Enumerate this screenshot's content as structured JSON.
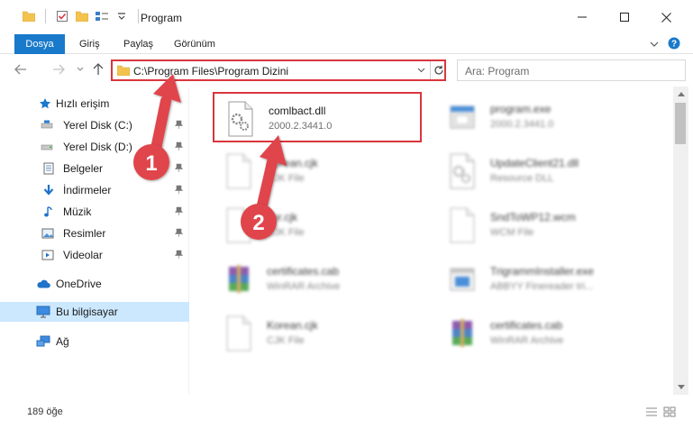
{
  "window": {
    "title": "Program"
  },
  "ribbon": {
    "tabs": [
      "Dosya",
      "Giriş",
      "Paylaş",
      "Görünüm"
    ]
  },
  "address": {
    "path": "C:\\Program Files\\Program Dizini"
  },
  "search": {
    "placeholder": "Ara: Program"
  },
  "sidebar": {
    "quick_access": "Hızlı erişim",
    "items": [
      {
        "label": "Yerel Disk (C:)",
        "icon": "drive-icon"
      },
      {
        "label": "Yerel Disk (D:)",
        "icon": "drive-icon"
      },
      {
        "label": "Belgeler",
        "icon": "documents-icon"
      },
      {
        "label": "İndirmeler",
        "icon": "download-icon"
      },
      {
        "label": "Müzik",
        "icon": "music-icon"
      },
      {
        "label": "Resimler",
        "icon": "pictures-icon"
      },
      {
        "label": "Videolar",
        "icon": "video-icon"
      }
    ],
    "onedrive": "OneDrive",
    "this_pc": "Bu bilgisayar",
    "network": "Ağ"
  },
  "files": [
    {
      "name": "comlbact.dll",
      "sub": "2000.2.3441.0",
      "icon": "dll-icon",
      "highlight": true
    },
    {
      "name": "program.exe",
      "sub": "2000.2.3441.0",
      "icon": "exe-icon"
    },
    {
      "name": "Korean.cjk",
      "sub": "CJK File",
      "icon": "file-icon"
    },
    {
      "name": "UpdateClient21.dll",
      "sub": "Resource DLL",
      "icon": "dll-icon"
    },
    {
      "name": "kor.cjk",
      "sub": "CJK File",
      "icon": "file-icon"
    },
    {
      "name": "SndToWP12.wcm",
      "sub": "WCM File",
      "icon": "file-icon"
    },
    {
      "name": "certificates.cab",
      "sub": "WinRAR Archive",
      "icon": "archive-icon"
    },
    {
      "name": "TrigrammInstaller.exe",
      "sub": "ABBYY Finereader tri...",
      "icon": "installer-icon"
    },
    {
      "name": "Korean.cjk",
      "sub": "CJK File",
      "icon": "file-icon"
    },
    {
      "name": "certificates.cab",
      "sub": "WinRAR Archive",
      "icon": "archive-icon"
    }
  ],
  "status": {
    "count": "189 öğe"
  },
  "annotations": [
    "1",
    "2"
  ],
  "colors": {
    "accent": "#1979ca",
    "highlight": "#d9363e",
    "selected": "#cce8ff"
  }
}
